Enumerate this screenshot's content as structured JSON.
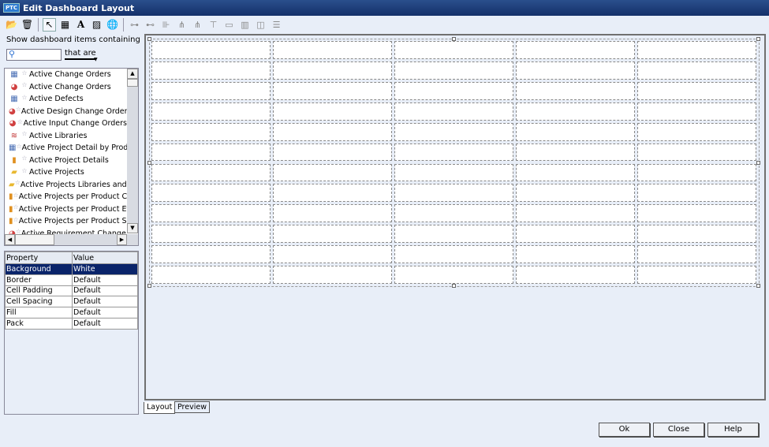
{
  "window": {
    "logo": "PTC",
    "title": "Edit Dashboard Layout"
  },
  "toolbar": [
    {
      "name": "new-icon",
      "glyph": "📂"
    },
    {
      "name": "trash-icon",
      "glyph": "🗑"
    },
    {
      "sep": true
    },
    {
      "name": "pointer-icon",
      "glyph": "↖",
      "selected": true
    },
    {
      "name": "table-icon",
      "glyph": "▦"
    },
    {
      "name": "text-icon",
      "glyph": "A"
    },
    {
      "name": "image-icon",
      "glyph": "▨"
    },
    {
      "name": "globe-icon",
      "glyph": "🌐"
    },
    {
      "sep": true
    },
    {
      "name": "split-left-icon",
      "glyph": "⊶",
      "dim": true
    },
    {
      "name": "split-right-icon",
      "glyph": "⊷",
      "dim": true
    },
    {
      "name": "insert-right-icon",
      "glyph": "⊪",
      "dim": true
    },
    {
      "name": "tree-icon",
      "glyph": "⋔",
      "dim": true
    },
    {
      "name": "tree-down-icon",
      "glyph": "⋔",
      "dim": true
    },
    {
      "name": "merge-icon",
      "glyph": "⊤",
      "dim": true
    },
    {
      "name": "layout-1-icon",
      "glyph": "▭",
      "dim": true
    },
    {
      "name": "layout-cols-icon",
      "glyph": "▥",
      "dim": true
    },
    {
      "name": "layout-side-icon",
      "glyph": "◫",
      "dim": true
    },
    {
      "name": "layout-rows-icon",
      "glyph": "☰",
      "dim": true
    }
  ],
  "filter": {
    "label": "Show dashboard items containing",
    "search_value": "",
    "qualifier": "that are"
  },
  "items": [
    {
      "icon": "report-icon",
      "glyph": "▦",
      "color": "#4a6fb5",
      "label": "Active Change Orders"
    },
    {
      "icon": "chart-pie-icon",
      "glyph": "◕",
      "color": "#d04040",
      "label": "Active Change Orders"
    },
    {
      "icon": "report-icon",
      "glyph": "▦",
      "color": "#4a6fb5",
      "label": "Active Defects"
    },
    {
      "icon": "chart-pie-icon",
      "glyph": "◕",
      "color": "#d04040",
      "label": "Active Design Change Orders"
    },
    {
      "icon": "chart-pie-icon",
      "glyph": "◕",
      "color": "#d04040",
      "label": "Active Input Change Orders"
    },
    {
      "icon": "books-icon",
      "glyph": "≋",
      "color": "#c03030",
      "label": "Active Libraries"
    },
    {
      "icon": "report-icon",
      "glyph": "▦",
      "color": "#4a6fb5",
      "label": "Active Project Detail by Produ"
    },
    {
      "icon": "bar-chart-icon",
      "glyph": "▮",
      "color": "#e09020",
      "label": "Active Project Details"
    },
    {
      "icon": "folder-icon",
      "glyph": "▰",
      "color": "#e8b830",
      "label": "Active Projects"
    },
    {
      "icon": "folder-icon",
      "glyph": "▰",
      "color": "#e8b830",
      "label": "Active Projects Libraries and T"
    },
    {
      "icon": "bar-chart-icon",
      "glyph": "▮",
      "color": "#e09020",
      "label": "Active Projects per Product Co"
    },
    {
      "icon": "bar-chart-icon",
      "glyph": "▮",
      "color": "#e09020",
      "label": "Active Projects per Product Ef"
    },
    {
      "icon": "bar-chart-icon",
      "glyph": "▮",
      "color": "#e09020",
      "label": "Active Projects per Product Su"
    },
    {
      "icon": "chart-pie-icon",
      "glyph": "◕",
      "color": "#d04040",
      "label": "Active Requirement Change C"
    }
  ],
  "properties": {
    "headers": [
      "Property",
      "Value"
    ],
    "rows": [
      [
        "Background",
        "White"
      ],
      [
        "Border",
        "Default"
      ],
      [
        "Cell Padding",
        "Default"
      ],
      [
        "Cell Spacing",
        "Default"
      ],
      [
        "Fill",
        "Default"
      ],
      [
        "Pack",
        "Default"
      ]
    ],
    "selected": 0
  },
  "grid": {
    "rows": 12,
    "cols": 5
  },
  "tabs": {
    "layout": "Layout",
    "preview": "Preview"
  },
  "buttons": {
    "ok": "Ok",
    "close": "Close",
    "help": "Help"
  }
}
